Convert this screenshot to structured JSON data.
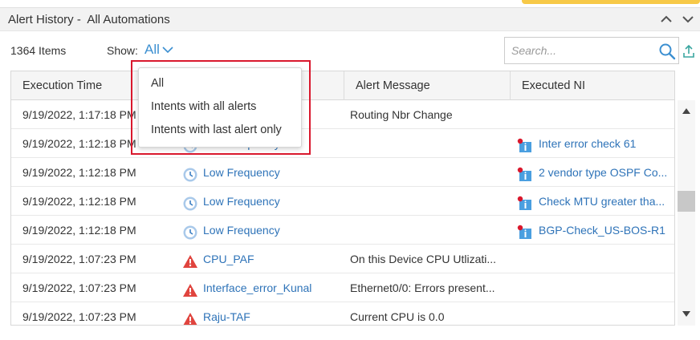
{
  "colors": {
    "accent": "#3b8fd1",
    "link": "#2e73b8",
    "alert_red": "#e0443e",
    "highlight": "#d9182d"
  },
  "panel": {
    "title": "Alert History -  All Automations"
  },
  "toolbar": {
    "items_count": "1364 Items",
    "show_label": "Show:",
    "show_value": "All",
    "search_placeholder": "Search..."
  },
  "grid": {
    "columns": [
      "Execution Time",
      "",
      "Alert Message",
      "Executed NI"
    ],
    "rows": [
      {
        "time": "9/19/2022, 1:17:18 PM",
        "intent": "",
        "intent_icon": "",
        "message": "Routing Nbr Change",
        "ni": "",
        "ni_icon": ""
      },
      {
        "time": "9/19/2022, 1:12:18 PM",
        "intent": "Low Frequency",
        "intent_icon": "clock-icon",
        "message": "",
        "ni": "Inter error check 61",
        "ni_icon": "ni-alert-icon"
      },
      {
        "time": "9/19/2022, 1:12:18 PM",
        "intent": "Low Frequency",
        "intent_icon": "clock-icon",
        "message": "",
        "ni": "2 vendor type OSPF Co...",
        "ni_icon": "ni-alert-icon"
      },
      {
        "time": "9/19/2022, 1:12:18 PM",
        "intent": "Low Frequency",
        "intent_icon": "clock-icon",
        "message": "",
        "ni": "Check MTU greater tha...",
        "ni_icon": "ni-alert-icon"
      },
      {
        "time": "9/19/2022, 1:12:18 PM",
        "intent": "Low Frequency",
        "intent_icon": "clock-icon",
        "message": "",
        "ni": "BGP-Check_US-BOS-R1",
        "ni_icon": "ni-alert-icon"
      },
      {
        "time": "9/19/2022, 1:07:23 PM",
        "intent": "CPU_PAF",
        "intent_icon": "warning-icon",
        "message": "On this Device CPU Utlizati...",
        "ni": "",
        "ni_icon": ""
      },
      {
        "time": "9/19/2022, 1:07:23 PM",
        "intent": "Interface_error_Kunal",
        "intent_icon": "warning-icon",
        "message": "Ethernet0/0: Errors present...",
        "ni": "",
        "ni_icon": ""
      },
      {
        "time": "9/19/2022, 1:07:23 PM",
        "intent": "Raju-TAF",
        "intent_icon": "warning-icon",
        "message": "Current CPU is 0.0",
        "ni": "",
        "ni_icon": ""
      }
    ]
  },
  "dropdown": {
    "options": [
      "All",
      "Intents with all alerts",
      "Intents with last alert only"
    ]
  }
}
